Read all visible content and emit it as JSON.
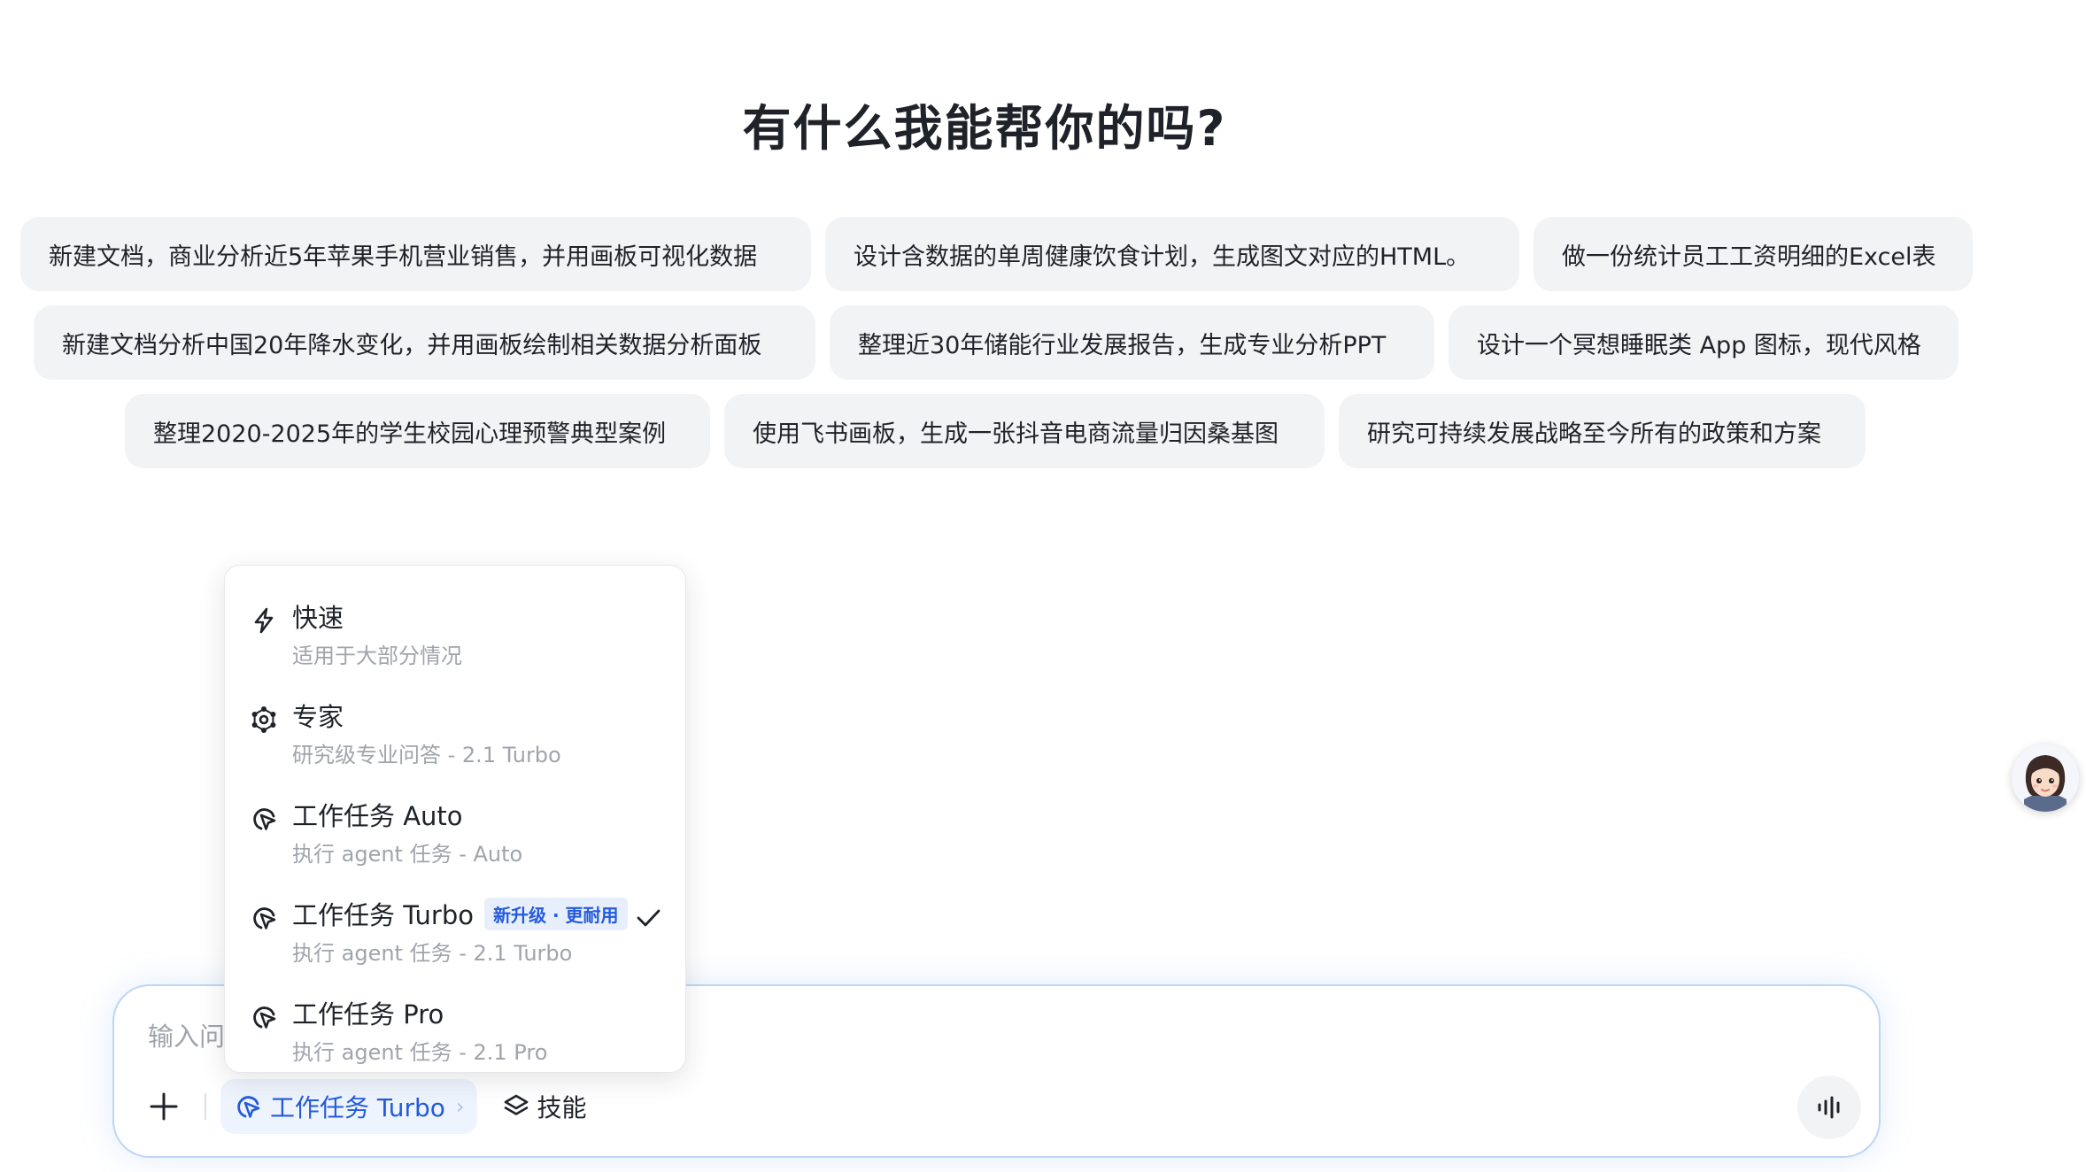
{
  "heading": "有什么我能帮你的吗?",
  "suggestions": [
    [
      "新建文档，商业分析近5年苹果手机营业销售，并用画板可视化数据",
      "设计含数据的单周健康饮食计划，生成图文对应的HTML。",
      "做一份统计员工工资明细的Excel表"
    ],
    [
      "新建文档分析中国20年降水变化，并用画板绘制相关数据分析面板",
      "整理近30年储能行业发展报告，生成专业分析PPT",
      "设计一个冥想睡眠类 App 图标，现代风格"
    ],
    [
      "整理2020-2025年的学生校园心理预警典型案例",
      "使用飞书画板，生成一张抖音电商流量归因桑基图",
      "研究可持续发展战略至今所有的政策和方案"
    ]
  ],
  "input": {
    "placeholder": "输入问"
  },
  "toolbar": {
    "mode_label": "工作任务 Turbo",
    "mode_caret": "›",
    "skill_label": "技能"
  },
  "dropdown": {
    "items": [
      {
        "title": "快速",
        "subtitle": "适用于大部分情况",
        "icon": "lightning-icon"
      },
      {
        "title": "专家",
        "subtitle": "研究级专业问答 - 2.1 Turbo",
        "icon": "expert-icon"
      },
      {
        "title": "工作任务 Auto",
        "subtitle": "执行 agent 任务 - Auto",
        "icon": "cursor-click-icon"
      },
      {
        "title": "工作任务 Turbo",
        "subtitle": "执行 agent 任务 - 2.1 Turbo",
        "icon": "cursor-click-icon",
        "badge": "新升级 · 更耐用",
        "selected": true
      },
      {
        "title": "工作任务 Pro",
        "subtitle": "执行 agent 任务 - 2.1 Pro",
        "icon": "cursor-click-icon"
      }
    ]
  },
  "colors": {
    "accent": "#245bdb",
    "chip_bg": "#f2f3f5",
    "input_border": "#bcd6f7"
  }
}
